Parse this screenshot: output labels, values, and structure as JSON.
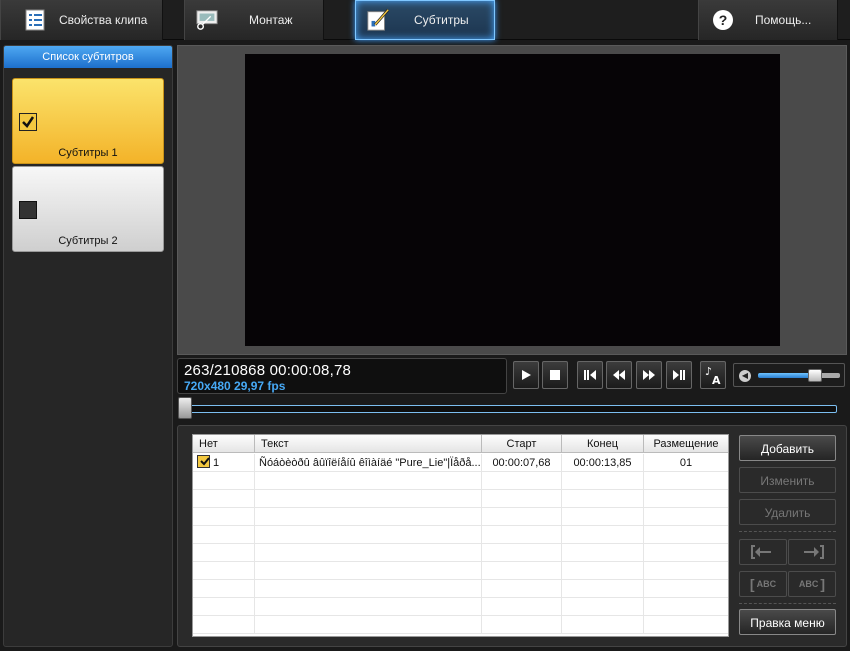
{
  "tabs": [
    {
      "label": "Свойства клипа",
      "icon": "list-icon"
    },
    {
      "label": "Монтаж",
      "icon": "scissors-film-icon"
    },
    {
      "label": "Субтитры",
      "icon": "subtitle-edit-icon",
      "active": true
    },
    {
      "label": "Помощь...",
      "icon": "help-icon"
    }
  ],
  "sidebar": {
    "title": "Список субтитров",
    "items": [
      {
        "label": "Субтитры 1",
        "checked": true
      },
      {
        "label": "Субтитры 2",
        "checked": false
      }
    ]
  },
  "info": {
    "frame_time": "263/210868  00:00:08,78",
    "format": "720x480 29,97  fps"
  },
  "player_controls": [
    "play-icon",
    "stop-icon",
    "step-back-icon",
    "rewind-icon",
    "fast-forward-icon",
    "step-forward-icon",
    "subtitle-font-icon"
  ],
  "volume": {
    "level": 0.7
  },
  "seek": {
    "position": 0.0
  },
  "table": {
    "columns": [
      "Нет",
      "Текст",
      "Старт",
      "Конец",
      "Размещение"
    ],
    "rows": [
      {
        "num": "1",
        "text": "Ñóáòèòðû âûïîëíåíû êîìàíäé \"Pure_Lie\"|Ïåðå...",
        "start": "00:00:07,68",
        "end": "00:00:13,85",
        "placement": "01",
        "checked": true
      }
    ]
  },
  "buttons": {
    "add": "Добавить",
    "edit": "Изменить",
    "delete": "Удалить",
    "edit_menu": "Правка меню",
    "abc_left": "ABC",
    "abc_right": "ABC"
  },
  "colors": {
    "accent": "#47a9f5",
    "selected_item": "#f3b329"
  }
}
